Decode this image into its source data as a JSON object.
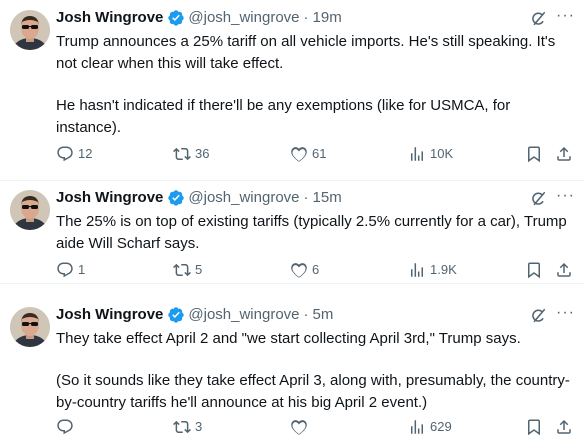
{
  "tweets": [
    {
      "author_name": "Josh Wingrove",
      "handle": "@josh_wingrove",
      "separator": "·",
      "time": "19m",
      "paragraphs": [
        "Trump announces a 25% tariff on all vehicle imports. He's still speaking. It's not clear when this will take effect.",
        "He hasn't indicated if there'll be any exemptions (like for USMCA, for instance)."
      ],
      "replies": "12",
      "retweets": "36",
      "likes": "61",
      "views": "10K"
    },
    {
      "author_name": "Josh Wingrove",
      "handle": "@josh_wingrove",
      "separator": "·",
      "time": "15m",
      "paragraphs": [
        "The 25% is on top of existing tariffs (typically 2.5% currently for a car), Trump aide Will Scharf says."
      ],
      "replies": "1",
      "retweets": "5",
      "likes": "6",
      "views": "1.9K"
    },
    {
      "author_name": "Josh Wingrove",
      "handle": "@josh_wingrove",
      "separator": "·",
      "time": "5m",
      "paragraphs": [
        "They take effect April 2 and \"we start collecting April 3rd,\" Trump says.",
        "(So it sounds like they take effect April 3, along with, presumably, the country-by-country tariffs he'll announce at his big April 2 event.)"
      ],
      "replies": "",
      "retweets": "3",
      "likes": "",
      "views": "629"
    }
  ],
  "more_label": "···",
  "colors": {
    "verified_badge": "#1d9bf0",
    "secondary_text": "#536471",
    "primary_text": "#0f1419"
  },
  "icons": {
    "verified": "verified-badge-icon",
    "grok": "grok-icon",
    "more": "more-options-icon",
    "reply": "reply-icon",
    "retweet": "retweet-icon",
    "like": "heart-icon",
    "views": "views-icon",
    "bookmark": "bookmark-icon",
    "share": "share-icon"
  }
}
